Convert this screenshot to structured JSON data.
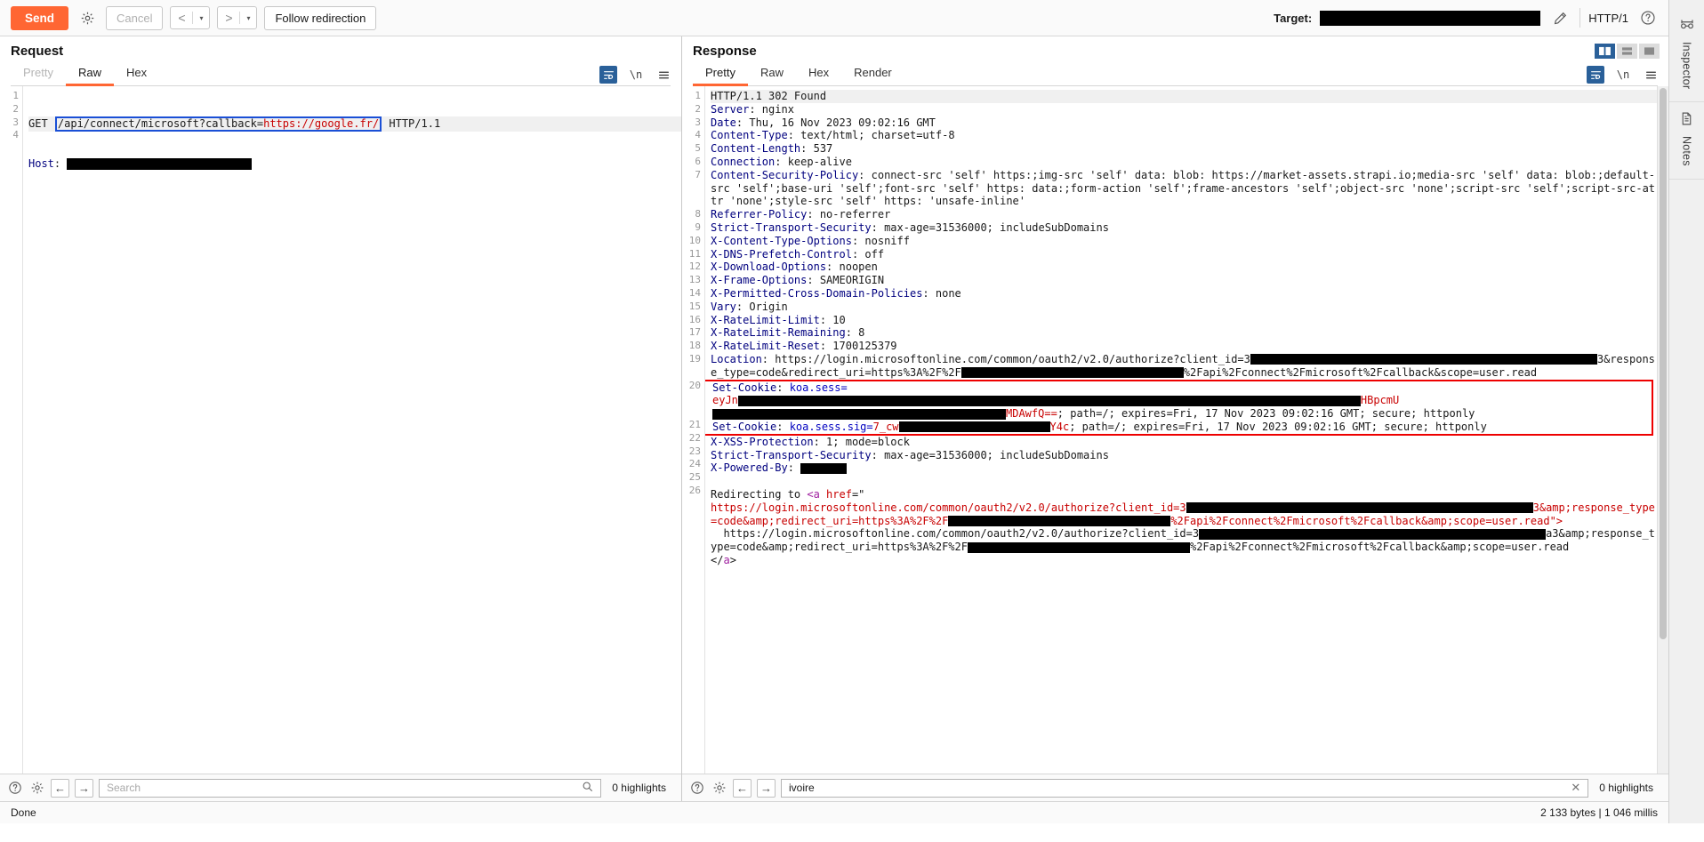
{
  "toolbar": {
    "send_label": "Send",
    "settings_icon": "gear-icon",
    "cancel_label": "Cancel",
    "prev_arrow": "<",
    "next_arrow": ">",
    "caret": "▾",
    "follow_redirection_label": "Follow redirection",
    "target_label": "Target:",
    "target_value_redacted": true,
    "edit_icon": "pencil-icon",
    "http_version": "HTTP/1",
    "help_icon": "question-mark-icon"
  },
  "request": {
    "title": "Request",
    "tabs": [
      {
        "label": "Pretty",
        "active": false,
        "muted": true
      },
      {
        "label": "Raw",
        "active": true,
        "muted": false
      },
      {
        "label": "Hex",
        "active": false,
        "muted": false
      }
    ],
    "icons": [
      "word-wrap-icon",
      "newline-icon",
      "menu-icon"
    ],
    "newline_glyph": "\\n",
    "lines": [
      {
        "n": 1,
        "method": "GET ",
        "path": "/api/connect/microsoft?callback=",
        "callback_url": "https://google.fr/",
        "proto": " HTTP/1.1",
        "selected": true
      },
      {
        "n": 2,
        "header": "Host",
        "value_redacted": true
      },
      {
        "n": 3,
        "text": ""
      },
      {
        "n": 4,
        "text": ""
      }
    ]
  },
  "response": {
    "title": "Response",
    "tabs": [
      {
        "label": "Pretty",
        "active": true
      },
      {
        "label": "Raw",
        "active": false
      },
      {
        "label": "Hex",
        "active": false
      },
      {
        "label": "Render",
        "active": false
      }
    ],
    "icons": [
      "word-wrap-icon",
      "newline-icon",
      "menu-icon"
    ],
    "newline_glyph": "\\n",
    "layout_toggles": [
      "split-vertical-icon",
      "split-horizontal-icon",
      "single-pane-icon"
    ],
    "status_line": "HTTP/1.1 302 Found",
    "headers": [
      {
        "n": 2,
        "name": "Server",
        "value": "nginx"
      },
      {
        "n": 3,
        "name": "Date",
        "value": "Thu, 16 Nov 2023 09:02:16 GMT"
      },
      {
        "n": 4,
        "name": "Content-Type",
        "value": "text/html; charset=utf-8"
      },
      {
        "n": 5,
        "name": "Content-Length",
        "value": "537"
      },
      {
        "n": 6,
        "name": "Connection",
        "value": "keep-alive"
      },
      {
        "n": 7,
        "name": "Content-Security-Policy",
        "value": "connect-src 'self' https:;img-src 'self' data: blob: https://market-assets.strapi.io;media-src 'self' data: blob:;default-src 'self';base-uri 'self';font-src 'self' https: data:;form-action 'self';frame-ancestors 'self';object-src 'none';script-src 'self';script-src-attr 'none';style-src 'self' https: 'unsafe-inline'"
      },
      {
        "n": 8,
        "name": "Referrer-Policy",
        "value": "no-referrer"
      },
      {
        "n": 9,
        "name": "Strict-Transport-Security",
        "value": "max-age=31536000; includeSubDomains"
      },
      {
        "n": 10,
        "name": "X-Content-Type-Options",
        "value": "nosniff"
      },
      {
        "n": 11,
        "name": "X-DNS-Prefetch-Control",
        "value": "off"
      },
      {
        "n": 12,
        "name": "X-Download-Options",
        "value": "noopen"
      },
      {
        "n": 13,
        "name": "X-Frame-Options",
        "value": "SAMEORIGIN"
      },
      {
        "n": 14,
        "name": "X-Permitted-Cross-Domain-Policies",
        "value": "none"
      },
      {
        "n": 15,
        "name": "Vary",
        "value": "Origin"
      },
      {
        "n": 16,
        "name": "X-RateLimit-Limit",
        "value": "10"
      },
      {
        "n": 17,
        "name": "X-RateLimit-Remaining",
        "value": "8"
      },
      {
        "n": 18,
        "name": "X-RateLimit-Reset",
        "value": "1700125379"
      }
    ],
    "location": {
      "n": 19,
      "name": "Location",
      "url_part1": "https://login.microsoftonline.com/common/oauth2/v2.0/authorize?client_id=3",
      "url_part2": "3&response_type=code&redirect_uri=https%3A%2F%2F",
      "url_part3": "%2Fapi%2Fconnect%2Fmicrosoft%2Fcallback&scope=user.read"
    },
    "cookies": [
      {
        "n": 20,
        "name": "Set-Cookie",
        "cookie_name": "koa.sess",
        "value_prefix": "eyJn",
        "value_mid": "HBpcmU",
        "value_tail": "MDAwfQ==",
        "attrs": "; path=/; expires=Fri, 17 Nov 2023 09:02:16 GMT; secure; httponly"
      },
      {
        "n": 21,
        "name": "Set-Cookie",
        "cookie_name": "koa.sess.sig",
        "value_prefix": "7_cw",
        "value_tail": "Y4c",
        "attrs": "; path=/; expires=Fri, 17 Nov 2023 09:02:16 GMT; secure; httponly"
      }
    ],
    "trailing_headers": [
      {
        "n": 22,
        "name": "X-XSS-Protection",
        "value": "1; mode=block"
      },
      {
        "n": 23,
        "name": "Strict-Transport-Security",
        "value": "max-age=31536000; includeSubDomains"
      },
      {
        "n": 24,
        "name": "X-Powered-By",
        "value_redacted": true
      }
    ],
    "blank_line_n": 25,
    "body": {
      "n": 26,
      "prefix": "Redirecting to ",
      "tag_open": "<a",
      "attr_name": " href",
      "eq_quote": "=\"",
      "href_part1": "https://login.microsoftonline.com/common/oauth2/v2.0/authorize?client_id=3",
      "href_part2": "3&amp;response_type=code&amp;redirect_uri=https%3A%2F%2F",
      "href_part3": "%2Fapi%2Fconnect%2Fmicrosoft%2Fcallback&amp;scope=user.read",
      "close_bracket": "\">",
      "link_text_part1": "https://login.microsoftonline.com/common/oauth2/v2.0/authorize?client_id=3",
      "link_text_part2": "a3&amp;response_type=code&amp;redirect_uri=https%3A%2F%2F",
      "link_text_part3": "%2Fapi%2Fconnect%2Fmicrosoft%2Fcallback&amp;scope=user.read",
      "tag_close_lt": "</",
      "tag_close_name": "a",
      "tag_close_gt": ">"
    }
  },
  "request_search": {
    "help_icon": "question-mark-icon",
    "settings_icon": "gear-icon",
    "back_icon": "←",
    "forward_icon": "→",
    "placeholder": "Search",
    "value": "",
    "magnifier_icon": "search-icon",
    "highlights": "0 highlights"
  },
  "response_search": {
    "help_icon": "question-mark-icon",
    "settings_icon": "gear-icon",
    "back_icon": "←",
    "forward_icon": "→",
    "placeholder": "Search",
    "value": "ivoire",
    "clear_icon": "✕",
    "highlights": "0 highlights"
  },
  "statusbar": {
    "left": "Done",
    "right": "2 133 bytes | 1 046 millis"
  },
  "sidebar": {
    "tabs": [
      {
        "label": "Inspector",
        "icon": "inspector-glasses-icon"
      },
      {
        "label": "Notes",
        "icon": "document-icon"
      }
    ]
  },
  "colors": {
    "accent": "#ff6633",
    "header_name": "#00007f",
    "string_red": "#c80000",
    "selection_blue": "#1a4fd6",
    "highlight_red": "#ee0000",
    "active_blue": "#2a6099"
  }
}
